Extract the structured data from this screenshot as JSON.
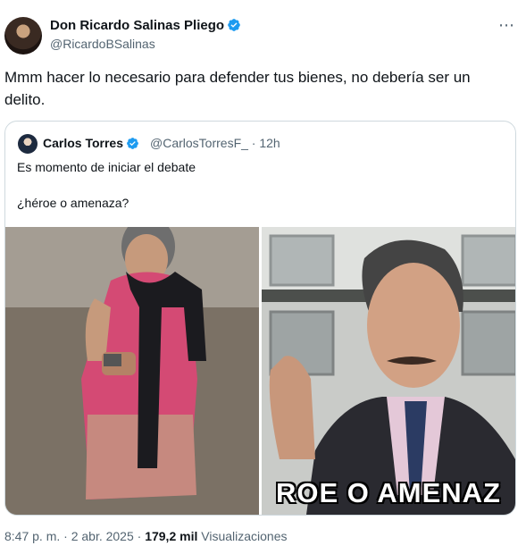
{
  "author": {
    "name": "Don Ricardo Salinas Pliego",
    "handle": "@RicardoBSalinas"
  },
  "more_icon": "⋯",
  "tweet_text": "Mmm hacer lo necesario para defender tus bienes, no debería ser un delito.",
  "quoted": {
    "name": "Carlos Torres",
    "handle_time": "@CarlosTorresF_ · 12h",
    "line1": "Es momento de iniciar el debate",
    "line2": "¿héroe o amenaza?",
    "image_caption": "ROE O AMENAZ"
  },
  "meta": {
    "time_date": "8:47 p. m. · 2 abr. 2025 · ",
    "views_count": "179,2 mil",
    "views_label": " Visualizaciones"
  },
  "colors": {
    "verified": "#1d9bf0",
    "secondary_text": "#536471",
    "border": "#cfd9de"
  }
}
